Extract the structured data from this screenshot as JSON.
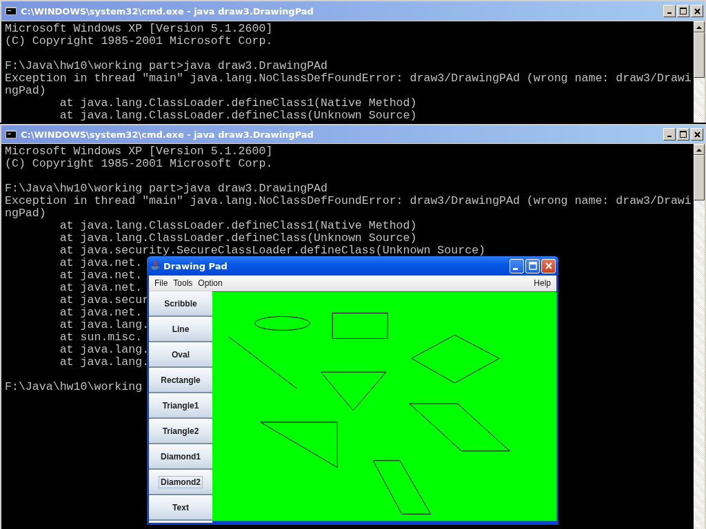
{
  "consoles": [
    {
      "title": "C:\\WINDOWS\\system32\\cmd.exe - java draw3.DrawingPad",
      "blocks": [
        [
          "Microsoft Windows XP [Version 5.1.2600]",
          "(C) Copyright 1985-2001 Microsoft Corp."
        ],
        [
          "F:\\Java\\hw10\\working part>java draw3.DrawingPAd",
          "Exception in thread \"main\" java.lang.NoClassDefFoundError: draw3/DrawingPAd (wrong name: draw3/Drawi",
          "ngPad)",
          "        at java.lang.ClassLoader.defineClass1(Native Method)",
          "        at java.lang.ClassLoader.defineClass(Unknown Source)"
        ]
      ]
    },
    {
      "title": "C:\\WINDOWS\\system32\\cmd.exe - java draw3.DrawingPad",
      "blocks": [
        [
          "Microsoft Windows XP [Version 5.1.2600]",
          "(C) Copyright 1985-2001 Microsoft Corp."
        ],
        [
          "F:\\Java\\hw10\\working part>java draw3.DrawingPAd",
          "Exception in thread \"main\" java.lang.NoClassDefFoundError: draw3/DrawingPAd (wrong name: draw3/Drawi",
          "ngPad)",
          "        at java.lang.ClassLoader.defineClass1(Native Method)",
          "        at java.lang.ClassLoader.defineClass(Unknown Source)",
          "        at java.security.SecureClassLoader.defineClass(Unknown Source)",
          "        at java.net.",
          "        at java.net.",
          "        at java.net.",
          "        at java.secur",
          "        at java.net.",
          "        at java.lang.",
          "        at sun.misc.",
          "        at java.lang.",
          "        at java.lang."
        ],
        [
          "F:\\Java\\hw10\\working"
        ]
      ]
    }
  ],
  "drawing_pad": {
    "title": "Drawing Pad",
    "menus": [
      "File",
      "Tools",
      "Option"
    ],
    "help_menu": "Help",
    "tools": [
      {
        "label": "Scribble",
        "focused": false
      },
      {
        "label": "Line",
        "focused": false
      },
      {
        "label": "Oval",
        "focused": false
      },
      {
        "label": "Rectangle",
        "focused": false
      },
      {
        "label": "Triangle1",
        "focused": false
      },
      {
        "label": "Triangle2",
        "focused": false
      },
      {
        "label": "Diamond1",
        "focused": false
      },
      {
        "label": "Diamond2",
        "focused": true
      },
      {
        "label": "Text",
        "focused": false
      }
    ]
  }
}
